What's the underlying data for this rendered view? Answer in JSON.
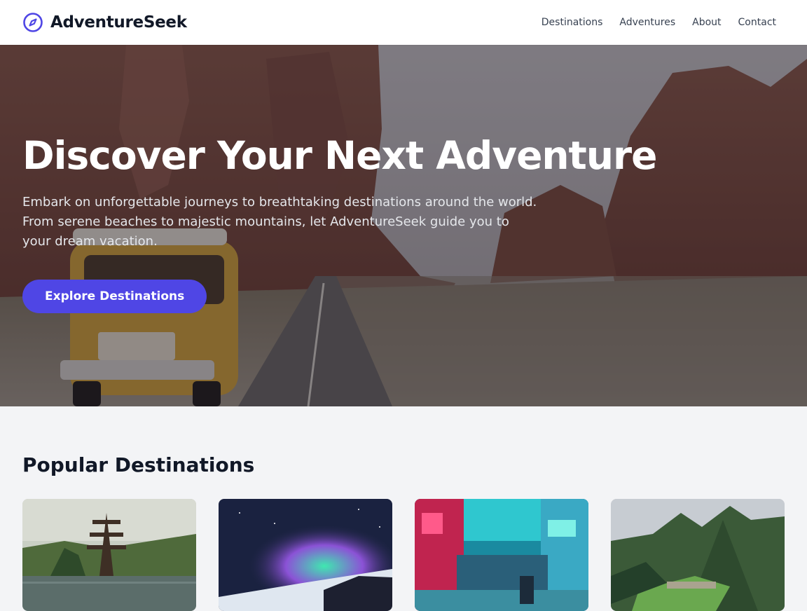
{
  "header": {
    "brand_name": "AdventureSeek",
    "brand_icon": "compass-icon",
    "brand_color": "#4f46e5",
    "nav": [
      {
        "label": "Destinations"
      },
      {
        "label": "Adventures"
      },
      {
        "label": "About"
      },
      {
        "label": "Contact"
      }
    ]
  },
  "hero": {
    "title": "Discover Your Next Adventure",
    "subtitle": "Embark on unforgettable journeys to breathtaking destinations around the world. From serene beaches to majestic mountains, let AdventureSeek guide you to your dream vacation.",
    "cta_label": "Explore Destinations",
    "cta_color": "#4f46e5"
  },
  "destinations": {
    "title": "Popular Destinations",
    "cards": [
      {
        "image": "temple-lake-photo"
      },
      {
        "image": "aurora-photo"
      },
      {
        "image": "neon-city-street-photo"
      },
      {
        "image": "mountain-ruins-photo"
      }
    ]
  }
}
